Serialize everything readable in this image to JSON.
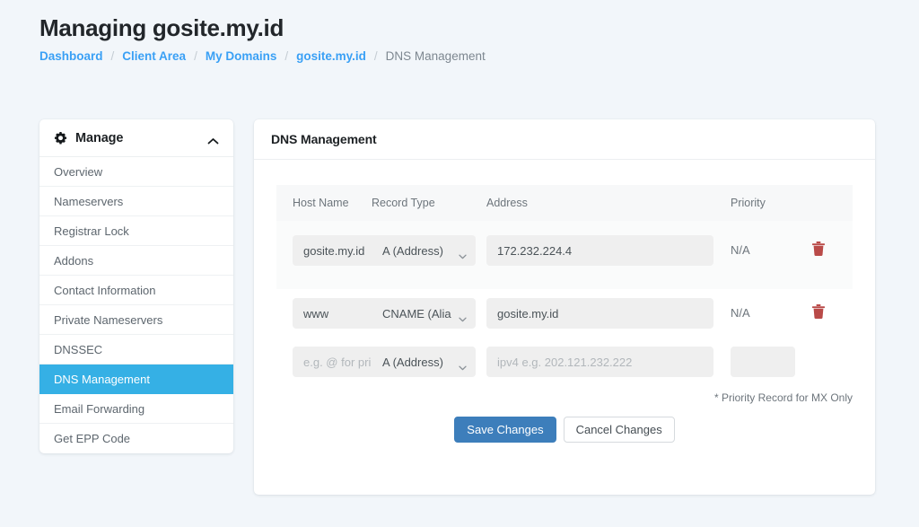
{
  "header": {
    "title": "Managing gosite.my.id",
    "breadcrumb": [
      {
        "label": "Dashboard",
        "current": false
      },
      {
        "label": "Client Area",
        "current": false
      },
      {
        "label": "My Domains",
        "current": false
      },
      {
        "label": "gosite.my.id",
        "current": false
      },
      {
        "label": "DNS Management",
        "current": true
      }
    ],
    "breadcrumb_separator": "/"
  },
  "sidebar": {
    "title": "Manage",
    "gear_icon": "gear-icon",
    "collapse_icon": "chevron-up-icon",
    "items": [
      {
        "label": "Overview",
        "active": false
      },
      {
        "label": "Nameservers",
        "active": false
      },
      {
        "label": "Registrar Lock",
        "active": false
      },
      {
        "label": "Addons",
        "active": false
      },
      {
        "label": "Contact Information",
        "active": false
      },
      {
        "label": "Private Nameservers",
        "active": false
      },
      {
        "label": "DNSSEC",
        "active": false
      },
      {
        "label": "DNS Management",
        "active": true
      },
      {
        "label": "Email Forwarding",
        "active": false
      },
      {
        "label": "Get EPP Code",
        "active": false
      }
    ]
  },
  "panel": {
    "title": "DNS Management",
    "table": {
      "columns": [
        "Host Name",
        "Record Type",
        "Address",
        "Priority",
        ""
      ],
      "rows": [
        {
          "host_name": "gosite.my.id",
          "host_placeholder": "",
          "record_type": "A (Address)",
          "address": "172.232.224.4",
          "address_placeholder": "",
          "priority_text": "N/A",
          "priority_value": null,
          "delete_icon": "trash-icon"
        },
        {
          "host_name": "www",
          "host_placeholder": "",
          "record_type": "CNAME (Alias)",
          "address": "gosite.my.id",
          "address_placeholder": "",
          "priority_text": "N/A",
          "priority_value": null,
          "delete_icon": "trash-icon"
        },
        {
          "host_name": "",
          "host_placeholder": "e.g. @ for primary",
          "record_type": "A (Address)",
          "address": "",
          "address_placeholder": "ipv4 e.g. 202.121.232.222",
          "priority_text": null,
          "priority_value": "",
          "delete_icon": null
        }
      ]
    },
    "note": "* Priority Record for MX Only",
    "save_label": "Save Changes",
    "cancel_label": "Cancel Changes"
  },
  "colors": {
    "page_background": "#f2f6fa",
    "breadcrumb_link": "#3aa0f5",
    "sidebar_active": "#35b0e5",
    "primary_button": "#3d7ebb",
    "trash_icon": "#b94a48"
  }
}
